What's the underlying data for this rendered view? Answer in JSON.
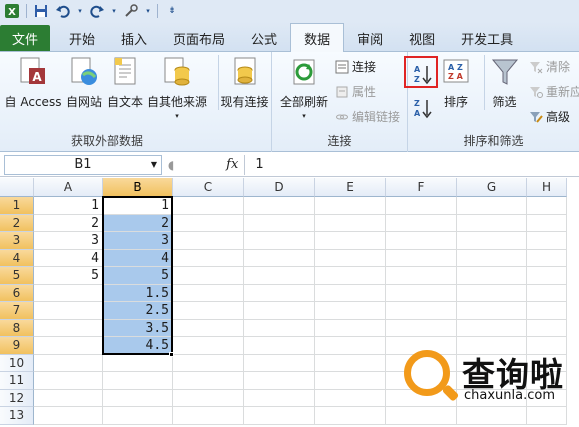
{
  "quick_access": {
    "icons": [
      "save-icon",
      "undo-icon",
      "redo-icon",
      "customize-icon"
    ]
  },
  "tabs": [
    {
      "label": "文件",
      "active": false
    },
    {
      "label": "开始",
      "active": false
    },
    {
      "label": "插入",
      "active": false
    },
    {
      "label": "页面布局",
      "active": false
    },
    {
      "label": "公式",
      "active": false
    },
    {
      "label": "数据",
      "active": true
    },
    {
      "label": "审阅",
      "active": false
    },
    {
      "label": "视图",
      "active": false
    },
    {
      "label": "开发工具",
      "active": false
    }
  ],
  "ribbon": {
    "get_external": {
      "label": "获取外部数据",
      "buttons": [
        "自 Access",
        "自网站",
        "自文本",
        "自其他来源",
        "现有连接"
      ]
    },
    "connections": {
      "label": "连接",
      "refresh_all": "全部刷新",
      "connections_btn": "连接",
      "properties_btn": "属性",
      "edit_links_btn": "编辑链接"
    },
    "sort_filter": {
      "label": "排序和筛选",
      "sort_btn": "排序",
      "filter_btn": "筛选",
      "clear_btn": "清除",
      "reapply_btn": "重新应",
      "advanced_btn": "高级"
    }
  },
  "formula_bar": {
    "name_box": "B1",
    "fx": "fx",
    "value": "1"
  },
  "sheet": {
    "columns": [
      "A",
      "B",
      "C",
      "D",
      "E",
      "F",
      "G",
      "H"
    ],
    "rows": [
      "1",
      "2",
      "3",
      "4",
      "5",
      "6",
      "7",
      "8",
      "9",
      "10",
      "11",
      "12",
      "13"
    ],
    "col_a": [
      "1",
      "2",
      "3",
      "4",
      "5",
      "",
      "",
      "",
      "",
      "",
      "",
      "",
      ""
    ],
    "col_b": [
      "1",
      "2",
      "3",
      "4",
      "5",
      "1.5",
      "2.5",
      "3.5",
      "4.5",
      "",
      "",
      "",
      ""
    ],
    "selected_column": "B",
    "selected_rows": [
      "1",
      "2",
      "3",
      "4",
      "5",
      "6",
      "7",
      "8",
      "9"
    ]
  },
  "watermark": {
    "title": "查询啦",
    "subtitle": "chaxunla.com"
  },
  "colors": {
    "file_tab": "#2c7d33",
    "selection_fill": "#a9c9ec",
    "header_selected": "#f1c15f",
    "highlight_box": "#e02424",
    "watermark_orange": "#f29a1a"
  }
}
